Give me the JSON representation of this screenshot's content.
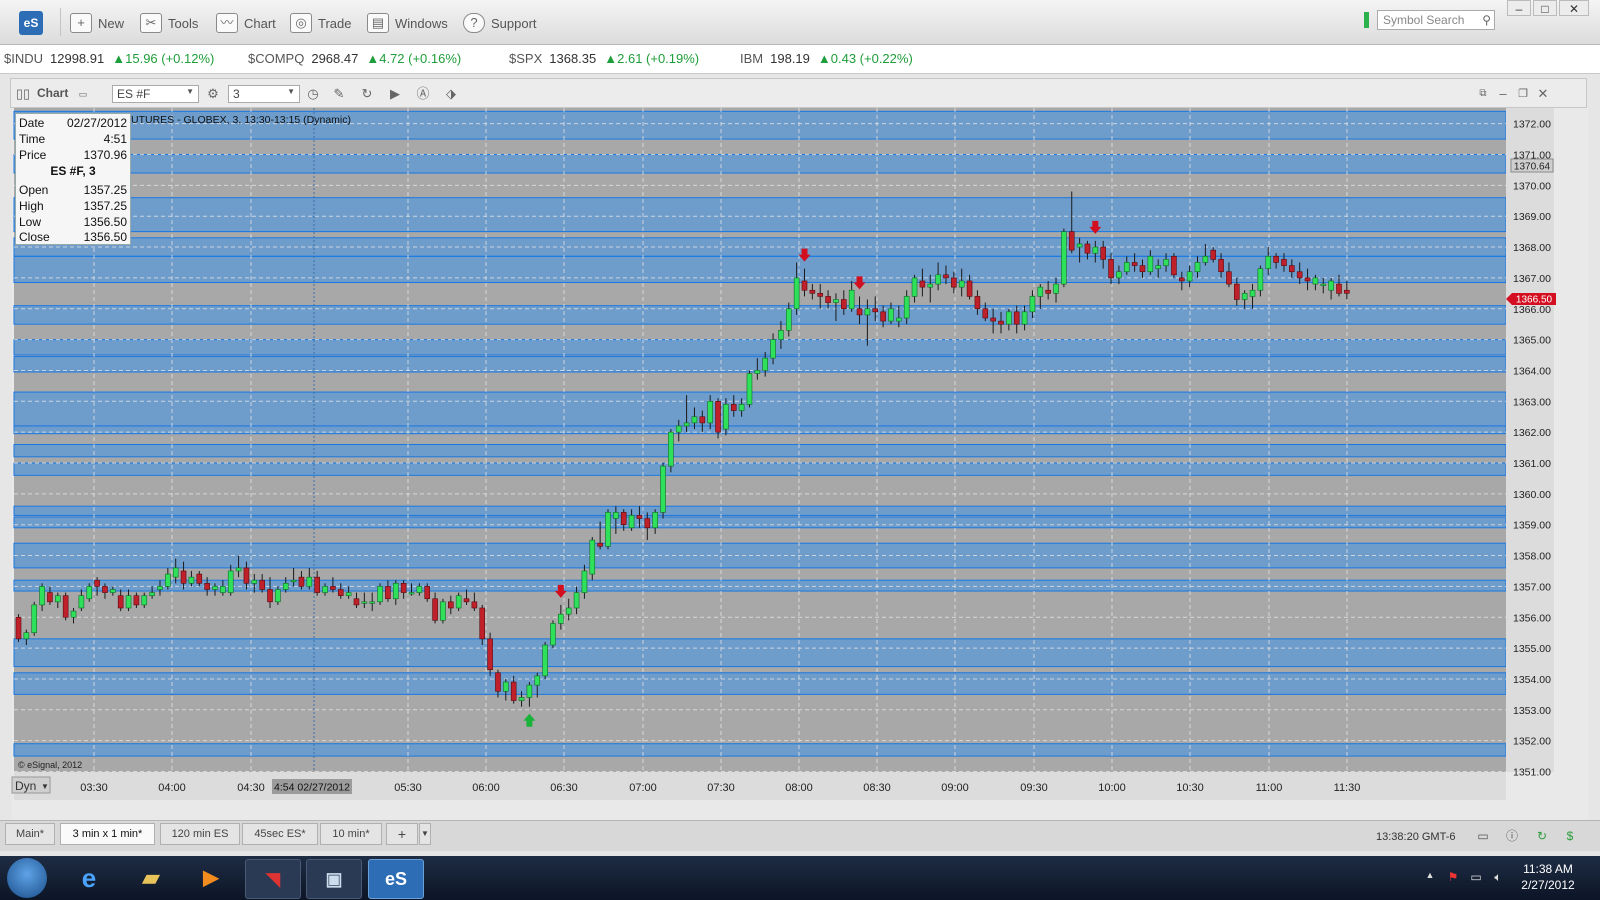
{
  "app": {
    "logo": "eS"
  },
  "toolbar": [
    {
      "label": "New",
      "icon": "new-icon"
    },
    {
      "label": "Tools",
      "icon": "tools-icon"
    },
    {
      "label": "Chart",
      "icon": "chart-icon"
    },
    {
      "label": "Trade",
      "icon": "trade-icon"
    },
    {
      "label": "Windows",
      "icon": "windows-icon"
    },
    {
      "label": "Support",
      "icon": "support-icon"
    }
  ],
  "search": {
    "placeholder": "Symbol Search"
  },
  "tickers": [
    {
      "symbol": "$INDU",
      "price": "12998.91",
      "change": "▲15.96 (+0.12%)"
    },
    {
      "symbol": "$COMPQ",
      "price": "2968.47",
      "change": "▲4.72 (+0.16%)"
    },
    {
      "symbol": "$SPX",
      "price": "1368.35",
      "change": "▲2.61 (+0.19%)"
    },
    {
      "symbol": "IBM",
      "price": "198.19",
      "change": "▲0.43 (+0.22%)"
    }
  ],
  "chart_window": {
    "title": "Chart",
    "symbol": "ES #F",
    "interval": "3"
  },
  "chart_data": {
    "type": "candlestick",
    "caption": "UTURES - GLOBEX, 3, 13:30-13:15 (Dynamic)",
    "copyright": "© eSignal, 2012",
    "ylim": [
      1350.75,
      1372.5
    ],
    "y_ticks": [
      "1351.00",
      "1352.00",
      "1353.00",
      "1354.00",
      "1355.00",
      "1356.00",
      "1357.00",
      "1358.00",
      "1359.00",
      "1360.00",
      "1361.00",
      "1362.00",
      "1363.00",
      "1364.00",
      "1365.00",
      "1366.00",
      "1367.00",
      "1368.00",
      "1369.00",
      "1370.00",
      "1371.00",
      "1372.00"
    ],
    "x_ticks": [
      "03:30",
      "04:00",
      "04:30",
      "05:30",
      "06:00",
      "06:30",
      "07:00",
      "07:30",
      "08:00",
      "08:30",
      "09:00",
      "09:30",
      "10:00",
      "10:30",
      "11:00",
      "11:30"
    ],
    "cursor_time_label": "4:54 02/27/2012",
    "last_price_label": "1366.50",
    "crosshair_price_label": "1370.64",
    "up_color": "#2ee05a",
    "down_color": "#c0202a",
    "background": "#a8a8a8",
    "band_color": "#1e90ff",
    "bands": [
      [
        1371.5,
        1372.4
      ],
      [
        1370.4,
        1371.0
      ],
      [
        1368.5,
        1369.6
      ],
      [
        1367.7,
        1368.3
      ],
      [
        1366.85,
        1367.7
      ],
      [
        1365.5,
        1366.1
      ],
      [
        1364.5,
        1365.0
      ],
      [
        1363.95,
        1364.45
      ],
      [
        1362.2,
        1363.3
      ],
      [
        1361.95,
        1362.2
      ],
      [
        1361.2,
        1361.6
      ],
      [
        1360.6,
        1361.0
      ],
      [
        1359.3,
        1359.6
      ],
      [
        1358.9,
        1359.25
      ],
      [
        1357.6,
        1358.4
      ],
      [
        1356.85,
        1357.2
      ],
      [
        1354.4,
        1355.3
      ],
      [
        1353.5,
        1354.2
      ],
      [
        1351.5,
        1351.9
      ]
    ],
    "candles": [
      [
        1356.0,
        1356.1,
        1355.2,
        1355.3
      ],
      [
        1355.3,
        1355.6,
        1355.1,
        1355.5
      ],
      [
        1355.5,
        1356.5,
        1355.4,
        1356.4
      ],
      [
        1356.4,
        1357.1,
        1356.2,
        1357.0
      ],
      [
        1356.8,
        1357.0,
        1356.4,
        1356.5
      ],
      [
        1356.5,
        1356.8,
        1356.3,
        1356.7
      ],
      [
        1356.7,
        1356.8,
        1355.9,
        1356.0
      ],
      [
        1356.0,
        1356.3,
        1355.8,
        1356.2
      ],
      [
        1356.3,
        1356.9,
        1356.2,
        1356.7
      ],
      [
        1356.6,
        1357.1,
        1356.5,
        1357.0
      ],
      [
        1357.2,
        1357.3,
        1356.7,
        1357.0
      ],
      [
        1357.0,
        1357.1,
        1356.6,
        1356.8
      ],
      [
        1356.8,
        1357.0,
        1356.7,
        1356.9
      ],
      [
        1356.7,
        1356.9,
        1356.2,
        1356.3
      ],
      [
        1356.3,
        1356.9,
        1356.2,
        1356.7
      ],
      [
        1356.7,
        1356.8,
        1356.3,
        1356.4
      ],
      [
        1356.4,
        1356.8,
        1356.3,
        1356.7
      ],
      [
        1356.7,
        1357.0,
        1356.6,
        1356.8
      ],
      [
        1356.9,
        1357.2,
        1356.7,
        1357.0
      ],
      [
        1357.0,
        1357.6,
        1356.9,
        1357.4
      ],
      [
        1357.3,
        1357.9,
        1357.1,
        1357.6
      ],
      [
        1357.5,
        1357.8,
        1356.9,
        1357.1
      ],
      [
        1357.1,
        1357.5,
        1357.0,
        1357.3
      ],
      [
        1357.4,
        1357.5,
        1357.0,
        1357.1
      ],
      [
        1357.1,
        1357.3,
        1356.7,
        1356.9
      ],
      [
        1356.9,
        1357.1,
        1356.7,
        1357.0
      ],
      [
        1356.8,
        1357.2,
        1356.7,
        1357.0
      ],
      [
        1356.8,
        1357.7,
        1356.7,
        1357.5
      ],
      [
        1357.5,
        1358.0,
        1357.3,
        1357.6
      ],
      [
        1357.6,
        1357.8,
        1356.9,
        1357.1
      ],
      [
        1357.1,
        1357.4,
        1356.8,
        1357.2
      ],
      [
        1357.2,
        1357.4,
        1356.8,
        1356.9
      ],
      [
        1356.9,
        1357.3,
        1356.3,
        1356.5
      ],
      [
        1356.5,
        1357.0,
        1356.4,
        1356.9
      ],
      [
        1356.9,
        1357.3,
        1356.8,
        1357.1
      ],
      [
        1357.2,
        1357.6,
        1357.0,
        1357.2
      ],
      [
        1357.3,
        1357.5,
        1356.9,
        1357.0
      ],
      [
        1357.0,
        1357.6,
        1356.9,
        1357.3
      ],
      [
        1357.3,
        1357.5,
        1356.7,
        1356.8
      ],
      [
        1356.8,
        1357.1,
        1356.7,
        1357.0
      ],
      [
        1357.0,
        1357.3,
        1356.8,
        1356.9
      ],
      [
        1356.9,
        1357.1,
        1356.6,
        1356.7
      ],
      [
        1356.7,
        1357.0,
        1356.6,
        1356.8
      ],
      [
        1356.6,
        1356.8,
        1356.3,
        1356.4
      ],
      [
        1356.5,
        1356.8,
        1356.3,
        1356.5
      ],
      [
        1356.5,
        1356.8,
        1356.2,
        1356.5
      ],
      [
        1356.5,
        1357.1,
        1356.4,
        1357.0
      ],
      [
        1357.0,
        1357.2,
        1356.5,
        1356.6
      ],
      [
        1356.6,
        1357.2,
        1356.4,
        1357.1
      ],
      [
        1357.1,
        1357.2,
        1356.6,
        1356.8
      ],
      [
        1356.8,
        1357.1,
        1356.7,
        1356.8
      ],
      [
        1356.8,
        1357.1,
        1356.7,
        1357.0
      ],
      [
        1357.0,
        1357.1,
        1356.5,
        1356.6
      ],
      [
        1356.6,
        1356.8,
        1355.8,
        1355.9
      ],
      [
        1355.9,
        1356.6,
        1355.8,
        1356.5
      ],
      [
        1356.5,
        1356.7,
        1356.1,
        1356.3
      ],
      [
        1356.3,
        1356.8,
        1356.2,
        1356.7
      ],
      [
        1356.6,
        1356.9,
        1356.4,
        1356.5
      ],
      [
        1356.5,
        1356.8,
        1356.2,
        1356.3
      ],
      [
        1356.3,
        1356.4,
        1355.1,
        1355.3
      ],
      [
        1355.3,
        1355.5,
        1354.1,
        1354.3
      ],
      [
        1354.2,
        1354.3,
        1353.4,
        1353.6
      ],
      [
        1353.6,
        1354.0,
        1353.3,
        1353.9
      ],
      [
        1353.9,
        1354.1,
        1353.2,
        1353.3
      ],
      [
        1353.3,
        1353.6,
        1353.1,
        1353.4
      ],
      [
        1353.4,
        1353.9,
        1353.1,
        1353.8
      ],
      [
        1353.8,
        1354.2,
        1353.4,
        1354.1
      ],
      [
        1354.1,
        1355.2,
        1354.0,
        1355.1
      ],
      [
        1355.1,
        1355.9,
        1355.0,
        1355.8
      ],
      [
        1355.8,
        1356.4,
        1355.6,
        1356.1
      ],
      [
        1356.1,
        1356.6,
        1355.9,
        1356.3
      ],
      [
        1356.3,
        1357.0,
        1356.1,
        1356.8
      ],
      [
        1356.8,
        1357.7,
        1356.6,
        1357.5
      ],
      [
        1357.4,
        1358.6,
        1357.2,
        1358.5
      ],
      [
        1358.4,
        1359.1,
        1358.2,
        1358.3
      ],
      [
        1358.3,
        1359.5,
        1358.2,
        1359.4
      ],
      [
        1359.2,
        1359.6,
        1358.7,
        1359.4
      ],
      [
        1359.4,
        1359.5,
        1358.8,
        1359.0
      ],
      [
        1358.9,
        1359.5,
        1358.8,
        1359.3
      ],
      [
        1359.3,
        1359.6,
        1358.9,
        1359.2
      ],
      [
        1359.2,
        1359.4,
        1358.5,
        1358.9
      ],
      [
        1358.9,
        1359.5,
        1358.7,
        1359.4
      ],
      [
        1359.4,
        1361.0,
        1359.2,
        1360.9
      ],
      [
        1360.9,
        1362.1,
        1360.7,
        1362.0
      ],
      [
        1362.0,
        1362.4,
        1361.7,
        1362.2
      ],
      [
        1362.2,
        1363.2,
        1362.0,
        1362.3
      ],
      [
        1362.3,
        1362.8,
        1362.1,
        1362.5
      ],
      [
        1362.5,
        1362.7,
        1362.0,
        1362.3
      ],
      [
        1362.3,
        1363.2,
        1362.1,
        1363.0
      ],
      [
        1363.0,
        1363.1,
        1361.8,
        1362.0
      ],
      [
        1362.1,
        1363.1,
        1361.9,
        1362.9
      ],
      [
        1362.9,
        1363.2,
        1362.5,
        1362.7
      ],
      [
        1362.7,
        1363.1,
        1362.5,
        1362.9
      ],
      [
        1362.9,
        1364.0,
        1362.8,
        1363.9
      ],
      [
        1363.9,
        1364.4,
        1363.7,
        1364.0
      ],
      [
        1364.0,
        1364.6,
        1363.8,
        1364.4
      ],
      [
        1364.4,
        1365.2,
        1364.2,
        1365.0
      ],
      [
        1365.0,
        1365.6,
        1364.7,
        1365.3
      ],
      [
        1365.3,
        1366.2,
        1365.1,
        1366.0
      ],
      [
        1366.0,
        1367.5,
        1365.8,
        1367.0
      ],
      [
        1366.9,
        1367.3,
        1366.4,
        1366.6
      ],
      [
        1366.6,
        1366.8,
        1366.3,
        1366.5
      ],
      [
        1366.5,
        1366.8,
        1366.0,
        1366.4
      ],
      [
        1366.4,
        1366.6,
        1366.0,
        1366.2
      ],
      [
        1366.2,
        1366.5,
        1365.6,
        1366.3
      ],
      [
        1366.3,
        1366.6,
        1365.8,
        1366.0
      ],
      [
        1366.0,
        1366.9,
        1365.9,
        1366.6
      ],
      [
        1366.0,
        1366.4,
        1365.5,
        1365.8
      ],
      [
        1365.8,
        1366.3,
        1364.8,
        1366.0
      ],
      [
        1366.0,
        1366.4,
        1365.6,
        1365.9
      ],
      [
        1365.9,
        1366.1,
        1365.4,
        1365.6
      ],
      [
        1365.6,
        1366.2,
        1365.5,
        1366.0
      ],
      [
        1365.6,
        1366.1,
        1365.4,
        1365.7
      ],
      [
        1365.7,
        1366.6,
        1365.5,
        1366.4
      ],
      [
        1366.4,
        1367.1,
        1366.2,
        1367.0
      ],
      [
        1366.9,
        1367.3,
        1366.4,
        1366.7
      ],
      [
        1366.7,
        1367.1,
        1366.2,
        1366.8
      ],
      [
        1366.8,
        1367.5,
        1366.6,
        1367.1
      ],
      [
        1367.1,
        1367.4,
        1366.8,
        1367.0
      ],
      [
        1367.0,
        1367.2,
        1366.5,
        1366.7
      ],
      [
        1366.7,
        1367.3,
        1366.4,
        1366.9
      ],
      [
        1366.9,
        1367.1,
        1366.3,
        1366.4
      ],
      [
        1366.4,
        1366.6,
        1365.8,
        1366.0
      ],
      [
        1366.0,
        1366.2,
        1365.6,
        1365.7
      ],
      [
        1365.7,
        1366.0,
        1365.2,
        1365.6
      ],
      [
        1365.6,
        1365.9,
        1365.2,
        1365.5
      ],
      [
        1365.5,
        1366.0,
        1365.3,
        1365.9
      ],
      [
        1365.9,
        1366.1,
        1365.2,
        1365.5
      ],
      [
        1365.5,
        1366.1,
        1365.3,
        1365.9
      ],
      [
        1365.9,
        1366.6,
        1365.7,
        1366.4
      ],
      [
        1366.4,
        1366.8,
        1366.0,
        1366.7
      ],
      [
        1366.6,
        1366.9,
        1366.3,
        1366.5
      ],
      [
        1366.5,
        1367.0,
        1366.2,
        1366.8
      ],
      [
        1366.8,
        1368.6,
        1366.7,
        1368.5
      ],
      [
        1368.5,
        1369.8,
        1367.8,
        1367.9
      ],
      [
        1368.0,
        1368.3,
        1367.5,
        1368.1
      ],
      [
        1368.1,
        1368.2,
        1367.6,
        1367.8
      ],
      [
        1367.8,
        1368.2,
        1367.5,
        1368.0
      ],
      [
        1368.0,
        1368.2,
        1367.3,
        1367.6
      ],
      [
        1367.6,
        1367.8,
        1366.8,
        1367.0
      ],
      [
        1367.0,
        1367.4,
        1366.8,
        1367.2
      ],
      [
        1367.2,
        1367.7,
        1367.1,
        1367.5
      ],
      [
        1367.5,
        1367.8,
        1367.2,
        1367.4
      ],
      [
        1367.4,
        1367.6,
        1367.0,
        1367.2
      ],
      [
        1367.2,
        1367.9,
        1367.1,
        1367.7
      ],
      [
        1367.3,
        1367.6,
        1367.0,
        1367.4
      ],
      [
        1367.4,
        1367.8,
        1367.2,
        1367.6
      ],
      [
        1367.7,
        1367.8,
        1367.0,
        1367.1
      ],
      [
        1367.0,
        1367.2,
        1366.6,
        1366.9
      ],
      [
        1366.9,
        1367.4,
        1366.7,
        1367.2
      ],
      [
        1367.2,
        1367.7,
        1367.0,
        1367.5
      ],
      [
        1367.5,
        1368.1,
        1367.4,
        1367.7
      ],
      [
        1367.9,
        1368.0,
        1367.5,
        1367.6
      ],
      [
        1367.6,
        1367.8,
        1367.0,
        1367.2
      ],
      [
        1367.2,
        1367.5,
        1366.7,
        1366.8
      ],
      [
        1366.8,
        1367.0,
        1366.1,
        1366.3
      ],
      [
        1366.3,
        1366.6,
        1366.0,
        1366.5
      ],
      [
        1366.4,
        1366.8,
        1366.0,
        1366.6
      ],
      [
        1366.6,
        1367.4,
        1366.4,
        1367.3
      ],
      [
        1367.3,
        1368.0,
        1367.1,
        1367.7
      ],
      [
        1367.7,
        1367.8,
        1367.3,
        1367.5
      ],
      [
        1367.6,
        1367.8,
        1367.2,
        1367.4
      ],
      [
        1367.4,
        1367.6,
        1367.0,
        1367.2
      ],
      [
        1367.2,
        1367.5,
        1366.8,
        1367.0
      ],
      [
        1367.0,
        1367.3,
        1366.6,
        1366.9
      ],
      [
        1366.8,
        1367.1,
        1366.6,
        1367.0
      ],
      [
        1366.8,
        1367.0,
        1366.5,
        1366.8
      ],
      [
        1366.6,
        1367.0,
        1366.3,
        1366.9
      ],
      [
        1366.8,
        1367.1,
        1366.4,
        1366.5
      ],
      [
        1366.6,
        1366.9,
        1366.3,
        1366.5
      ]
    ],
    "down_arrows": [
      69,
      100,
      107,
      137
    ],
    "up_arrows": [
      65
    ]
  },
  "infobox": {
    "date_label": "Date",
    "date": "02/27/2012",
    "time_label": "Time",
    "time": "4:51",
    "price_label": "Price",
    "price": "1370.96",
    "series": "ES #F, 3",
    "open_label": "Open",
    "open": "1357.25",
    "high_label": "High",
    "high": "1357.25",
    "low_label": "Low",
    "low": "1356.50",
    "close_label": "Close",
    "close": "1356.50"
  },
  "dyn_label": "Dyn",
  "tabs": [
    {
      "label": "Main*"
    },
    {
      "label": "3 min x 1 min*",
      "active": true
    },
    {
      "label": "120 min ES"
    },
    {
      "label": "45sec ES*"
    },
    {
      "label": "10 min*"
    },
    {
      "label": "+"
    }
  ],
  "status": {
    "time": "13:38:20 GMT-6"
  },
  "taskbar": {
    "clock_time": "11:38 AM",
    "clock_date": "2/27/2012",
    "app_es_label": "eS"
  }
}
